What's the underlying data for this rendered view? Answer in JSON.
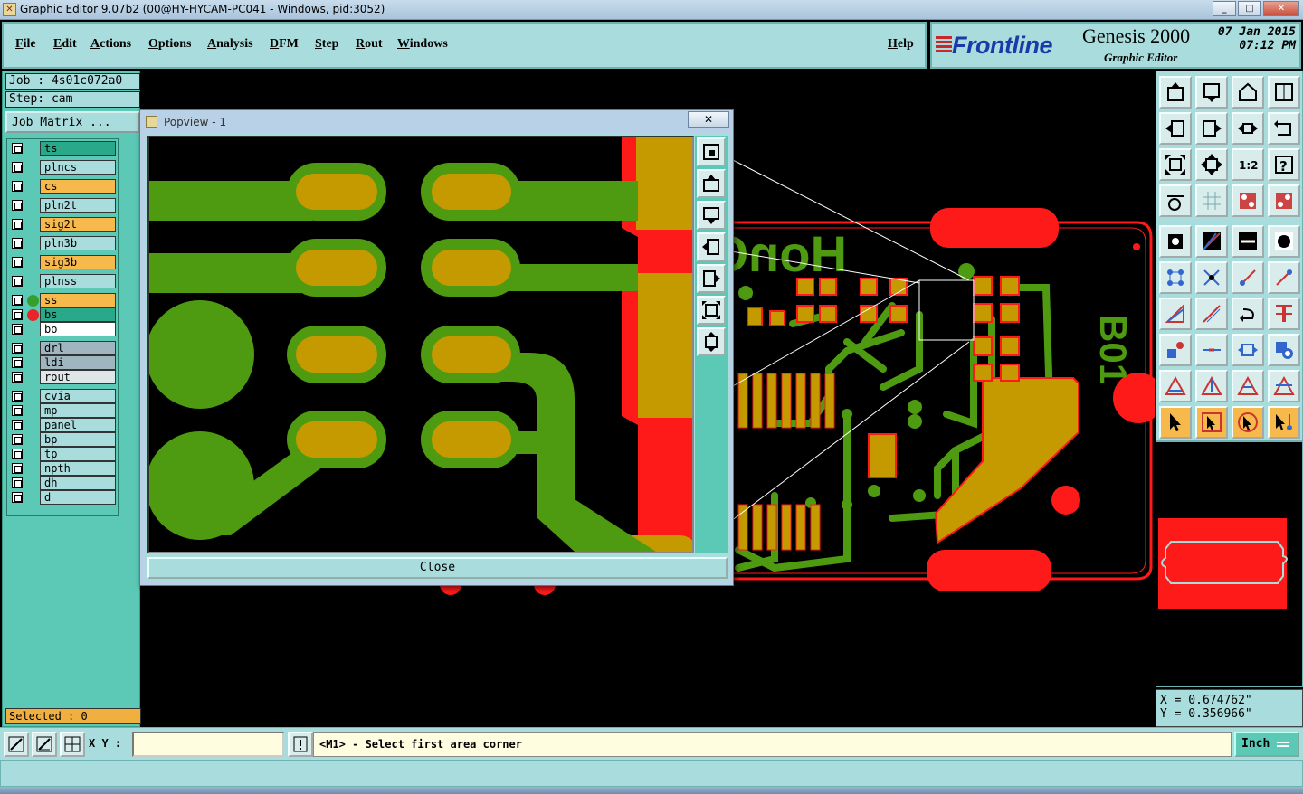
{
  "window": {
    "title": "Graphic Editor 9.07b2 (00@HY-HYCAM-PC041 - Windows, pid:3052)",
    "controls": [
      "_",
      "□",
      "✕"
    ]
  },
  "menu": {
    "items": [
      "File",
      "Edit",
      "Actions",
      "Options",
      "Analysis",
      "DFM",
      "Step",
      "Rout",
      "Windows"
    ],
    "help": "Help"
  },
  "brand": {
    "logo": "Frontline",
    "product": "Genesis 2000",
    "subtitle": "Graphic Editor",
    "date": "07 Jan 2015",
    "time": "07:12 PM"
  },
  "job": {
    "job_label": "Job : 4s01c072a0",
    "step_label": "Step: cam",
    "matrix_button": "Job Matrix ..."
  },
  "layers": [
    {
      "name": "ts",
      "color": "#2aa88a",
      "dot": ""
    },
    {
      "name": "plncs",
      "color": "#a9dcdc",
      "dot": ""
    },
    {
      "name": "cs",
      "color": "#f7b94c",
      "dot": ""
    },
    {
      "name": "pln2t",
      "color": "#a9dcdc",
      "dot": ""
    },
    {
      "name": "sig2t",
      "color": "#f7b94c",
      "dot": ""
    },
    {
      "name": "pln3b",
      "color": "#a9dcdc",
      "dot": ""
    },
    {
      "name": "sig3b",
      "color": "#f7b94c",
      "dot": ""
    },
    {
      "name": "plnss",
      "color": "#a9dcdc",
      "dot": ""
    },
    {
      "name": "ss",
      "color": "#f7b94c",
      "dot": "#34a02c"
    },
    {
      "name": "bs",
      "color": "#2aa88a",
      "dot": "#e8262a"
    },
    {
      "name": "bo",
      "color": "#ffffff",
      "dot": ""
    },
    {
      "name": "drl",
      "color": "#9fb6c0",
      "dot": ""
    },
    {
      "name": "ldi",
      "color": "#9fb6c0",
      "dot": ""
    },
    {
      "name": "rout",
      "color": "#dfe6e8",
      "dot": ""
    },
    {
      "name": "cvia",
      "color": "#a9dcdc",
      "dot": ""
    },
    {
      "name": "mp",
      "color": "#a9dcdc",
      "dot": ""
    },
    {
      "name": "panel",
      "color": "#a9dcdc",
      "dot": ""
    },
    {
      "name": "bp",
      "color": "#a9dcdc",
      "dot": ""
    },
    {
      "name": "tp",
      "color": "#a9dcdc",
      "dot": ""
    },
    {
      "name": "npth",
      "color": "#a9dcdc",
      "dot": ""
    },
    {
      "name": "dh",
      "color": "#a9dcdc",
      "dot": ""
    },
    {
      "name": "d",
      "color": "#a9dcdc",
      "dot": ""
    }
  ],
  "selected": "Selected : 0",
  "canvas": {
    "text_main": "HonO",
    "text_side": "B01"
  },
  "popview": {
    "title": "Popview - 1",
    "close_x": "✕",
    "close_button": "Close"
  },
  "coords": {
    "x": "X = 0.674762\"",
    "y": "Y = 0.356966\""
  },
  "bottom": {
    "xy_label": "X Y :",
    "xy_value": "",
    "prompt": "<M1> - Select first area corner",
    "units": "Inch"
  },
  "colors": {
    "copper": "#4e9a10",
    "pad": "#c49a00",
    "mask": "#ff1a1a",
    "panel_bg": "#a9dcdc",
    "teal": "#5cc9b6"
  }
}
